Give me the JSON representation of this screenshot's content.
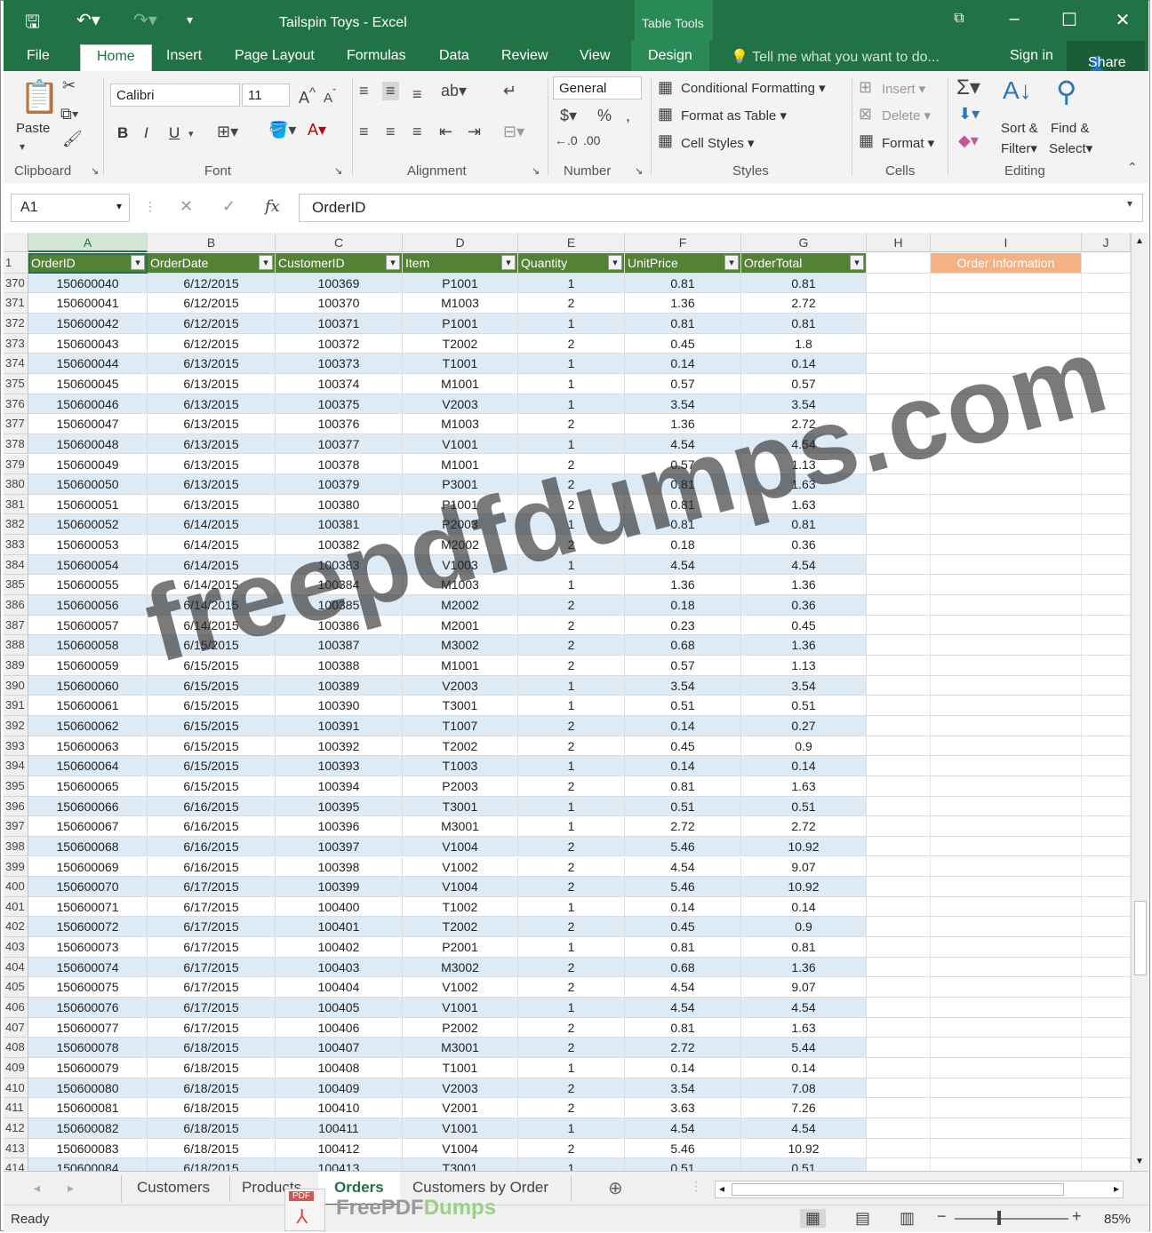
{
  "window": {
    "title": "Tailspin Toys - Excel",
    "context_tab": "Table Tools"
  },
  "ribbon_tabs": [
    "File",
    "Home",
    "Insert",
    "Page Layout",
    "Formulas",
    "Data",
    "Review",
    "View",
    "Design"
  ],
  "active_tab": "Home",
  "tell_me": "Tell me what you want to do...",
  "sign_in": "Sign in",
  "share": "Share",
  "ribbon": {
    "clipboard": {
      "paste": "Paste",
      "label": "Clipboard"
    },
    "font": {
      "name": "Calibri",
      "size": "11",
      "label": "Font",
      "bold": "B",
      "italic": "I",
      "underline": "U"
    },
    "alignment": {
      "label": "Alignment"
    },
    "number": {
      "format": "General",
      "label": "Number"
    },
    "styles": {
      "conditional": "Conditional Formatting",
      "format_table": "Format as Table",
      "cell_styles": "Cell Styles",
      "label": "Styles"
    },
    "cells": {
      "insert": "Insert",
      "delete": "Delete",
      "format": "Format",
      "label": "Cells"
    },
    "editing": {
      "sort_1": "Sort &",
      "sort_2": "Filter",
      "find_1": "Find &",
      "find_2": "Select",
      "label": "Editing"
    }
  },
  "formula_bar": {
    "name_box": "A1",
    "fx": "fx",
    "value": "OrderID"
  },
  "columns": [
    "A",
    "B",
    "C",
    "D",
    "E",
    "F",
    "G",
    "H",
    "I",
    "J"
  ],
  "table_headers": [
    "OrderID",
    "OrderDate",
    "CustomerID",
    "Item",
    "Quantity",
    "UnitPrice",
    "OrderTotal"
  ],
  "order_info_label": "Order Information",
  "header_row_number": "1",
  "rows": [
    [
      "370",
      "150600040",
      "6/12/2015",
      "100369",
      "P1001",
      "1",
      "0.81",
      "0.81"
    ],
    [
      "371",
      "150600041",
      "6/12/2015",
      "100370",
      "M1003",
      "2",
      "1.36",
      "2.72"
    ],
    [
      "372",
      "150600042",
      "6/12/2015",
      "100371",
      "P1001",
      "1",
      "0.81",
      "0.81"
    ],
    [
      "373",
      "150600043",
      "6/12/2015",
      "100372",
      "T2002",
      "2",
      "0.45",
      "1.8"
    ],
    [
      "374",
      "150600044",
      "6/13/2015",
      "100373",
      "T1001",
      "1",
      "0.14",
      "0.14"
    ],
    [
      "375",
      "150600045",
      "6/13/2015",
      "100374",
      "M1001",
      "1",
      "0.57",
      "0.57"
    ],
    [
      "376",
      "150600046",
      "6/13/2015",
      "100375",
      "V2003",
      "1",
      "3.54",
      "3.54"
    ],
    [
      "377",
      "150600047",
      "6/13/2015",
      "100376",
      "M1003",
      "2",
      "1.36",
      "2.72"
    ],
    [
      "378",
      "150600048",
      "6/13/2015",
      "100377",
      "V1001",
      "1",
      "4.54",
      "4.54"
    ],
    [
      "379",
      "150600049",
      "6/13/2015",
      "100378",
      "M1001",
      "2",
      "0.57",
      "1.13"
    ],
    [
      "380",
      "150600050",
      "6/13/2015",
      "100379",
      "P3001",
      "2",
      "0.81",
      "1.63"
    ],
    [
      "381",
      "150600051",
      "6/13/2015",
      "100380",
      "P1001",
      "2",
      "0.81",
      "1.63"
    ],
    [
      "382",
      "150600052",
      "6/14/2015",
      "100381",
      "P2003",
      "1",
      "0.81",
      "0.81"
    ],
    [
      "383",
      "150600053",
      "6/14/2015",
      "100382",
      "M2002",
      "2",
      "0.18",
      "0.36"
    ],
    [
      "384",
      "150600054",
      "6/14/2015",
      "100383",
      "V1003",
      "1",
      "4.54",
      "4.54"
    ],
    [
      "385",
      "150600055",
      "6/14/2015",
      "100384",
      "M1003",
      "1",
      "1.36",
      "1.36"
    ],
    [
      "386",
      "150600056",
      "6/14/2015",
      "100385",
      "M2002",
      "2",
      "0.18",
      "0.36"
    ],
    [
      "387",
      "150600057",
      "6/14/2015",
      "100386",
      "M2001",
      "2",
      "0.23",
      "0.45"
    ],
    [
      "388",
      "150600058",
      "6/15/2015",
      "100387",
      "M3002",
      "2",
      "0.68",
      "1.36"
    ],
    [
      "389",
      "150600059",
      "6/15/2015",
      "100388",
      "M1001",
      "2",
      "0.57",
      "1.13"
    ],
    [
      "390",
      "150600060",
      "6/15/2015",
      "100389",
      "V2003",
      "1",
      "3.54",
      "3.54"
    ],
    [
      "391",
      "150600061",
      "6/15/2015",
      "100390",
      "T3001",
      "1",
      "0.51",
      "0.51"
    ],
    [
      "392",
      "150600062",
      "6/15/2015",
      "100391",
      "T1007",
      "2",
      "0.14",
      "0.27"
    ],
    [
      "393",
      "150600063",
      "6/15/2015",
      "100392",
      "T2002",
      "2",
      "0.45",
      "0.9"
    ],
    [
      "394",
      "150600064",
      "6/15/2015",
      "100393",
      "T1003",
      "1",
      "0.14",
      "0.14"
    ],
    [
      "395",
      "150600065",
      "6/15/2015",
      "100394",
      "P2003",
      "2",
      "0.81",
      "1.63"
    ],
    [
      "396",
      "150600066",
      "6/16/2015",
      "100395",
      "T3001",
      "1",
      "0.51",
      "0.51"
    ],
    [
      "397",
      "150600067",
      "6/16/2015",
      "100396",
      "M3001",
      "1",
      "2.72",
      "2.72"
    ],
    [
      "398",
      "150600068",
      "6/16/2015",
      "100397",
      "V1004",
      "2",
      "5.46",
      "10.92"
    ],
    [
      "399",
      "150600069",
      "6/16/2015",
      "100398",
      "V1002",
      "2",
      "4.54",
      "9.07"
    ],
    [
      "400",
      "150600070",
      "6/17/2015",
      "100399",
      "V1004",
      "2",
      "5.46",
      "10.92"
    ],
    [
      "401",
      "150600071",
      "6/17/2015",
      "100400",
      "T1002",
      "1",
      "0.14",
      "0.14"
    ],
    [
      "402",
      "150600072",
      "6/17/2015",
      "100401",
      "T2002",
      "2",
      "0.45",
      "0.9"
    ],
    [
      "403",
      "150600073",
      "6/17/2015",
      "100402",
      "P2001",
      "1",
      "0.81",
      "0.81"
    ],
    [
      "404",
      "150600074",
      "6/17/2015",
      "100403",
      "M3002",
      "2",
      "0.68",
      "1.36"
    ],
    [
      "405",
      "150600075",
      "6/17/2015",
      "100404",
      "V1002",
      "2",
      "4.54",
      "9.07"
    ],
    [
      "406",
      "150600076",
      "6/17/2015",
      "100405",
      "V1001",
      "1",
      "4.54",
      "4.54"
    ],
    [
      "407",
      "150600077",
      "6/17/2015",
      "100406",
      "P2002",
      "2",
      "0.81",
      "1.63"
    ],
    [
      "408",
      "150600078",
      "6/18/2015",
      "100407",
      "M3001",
      "2",
      "2.72",
      "5.44"
    ],
    [
      "409",
      "150600079",
      "6/18/2015",
      "100408",
      "T1001",
      "1",
      "0.14",
      "0.14"
    ],
    [
      "410",
      "150600080",
      "6/18/2015",
      "100409",
      "V2003",
      "2",
      "3.54",
      "7.08"
    ],
    [
      "411",
      "150600081",
      "6/18/2015",
      "100410",
      "V2001",
      "2",
      "3.63",
      "7.26"
    ],
    [
      "412",
      "150600082",
      "6/18/2015",
      "100411",
      "V1001",
      "1",
      "4.54",
      "4.54"
    ],
    [
      "413",
      "150600083",
      "6/18/2015",
      "100412",
      "V1004",
      "2",
      "5.46",
      "10.92"
    ],
    [
      "414",
      "150600084",
      "6/18/2015",
      "100413",
      "T3001",
      "1",
      "0.51",
      "0.51"
    ]
  ],
  "sheet_tabs": [
    "Customers",
    "Products",
    "Orders",
    "Customers by Order"
  ],
  "active_sheet": "Orders",
  "status": {
    "ready": "Ready",
    "zoom": "85%"
  },
  "watermark": {
    "main": "freepdfdumps.com",
    "brand_a": "Free",
    "brand_b": "PDF",
    "brand_c": "Dumps",
    "badge": "PDF"
  }
}
